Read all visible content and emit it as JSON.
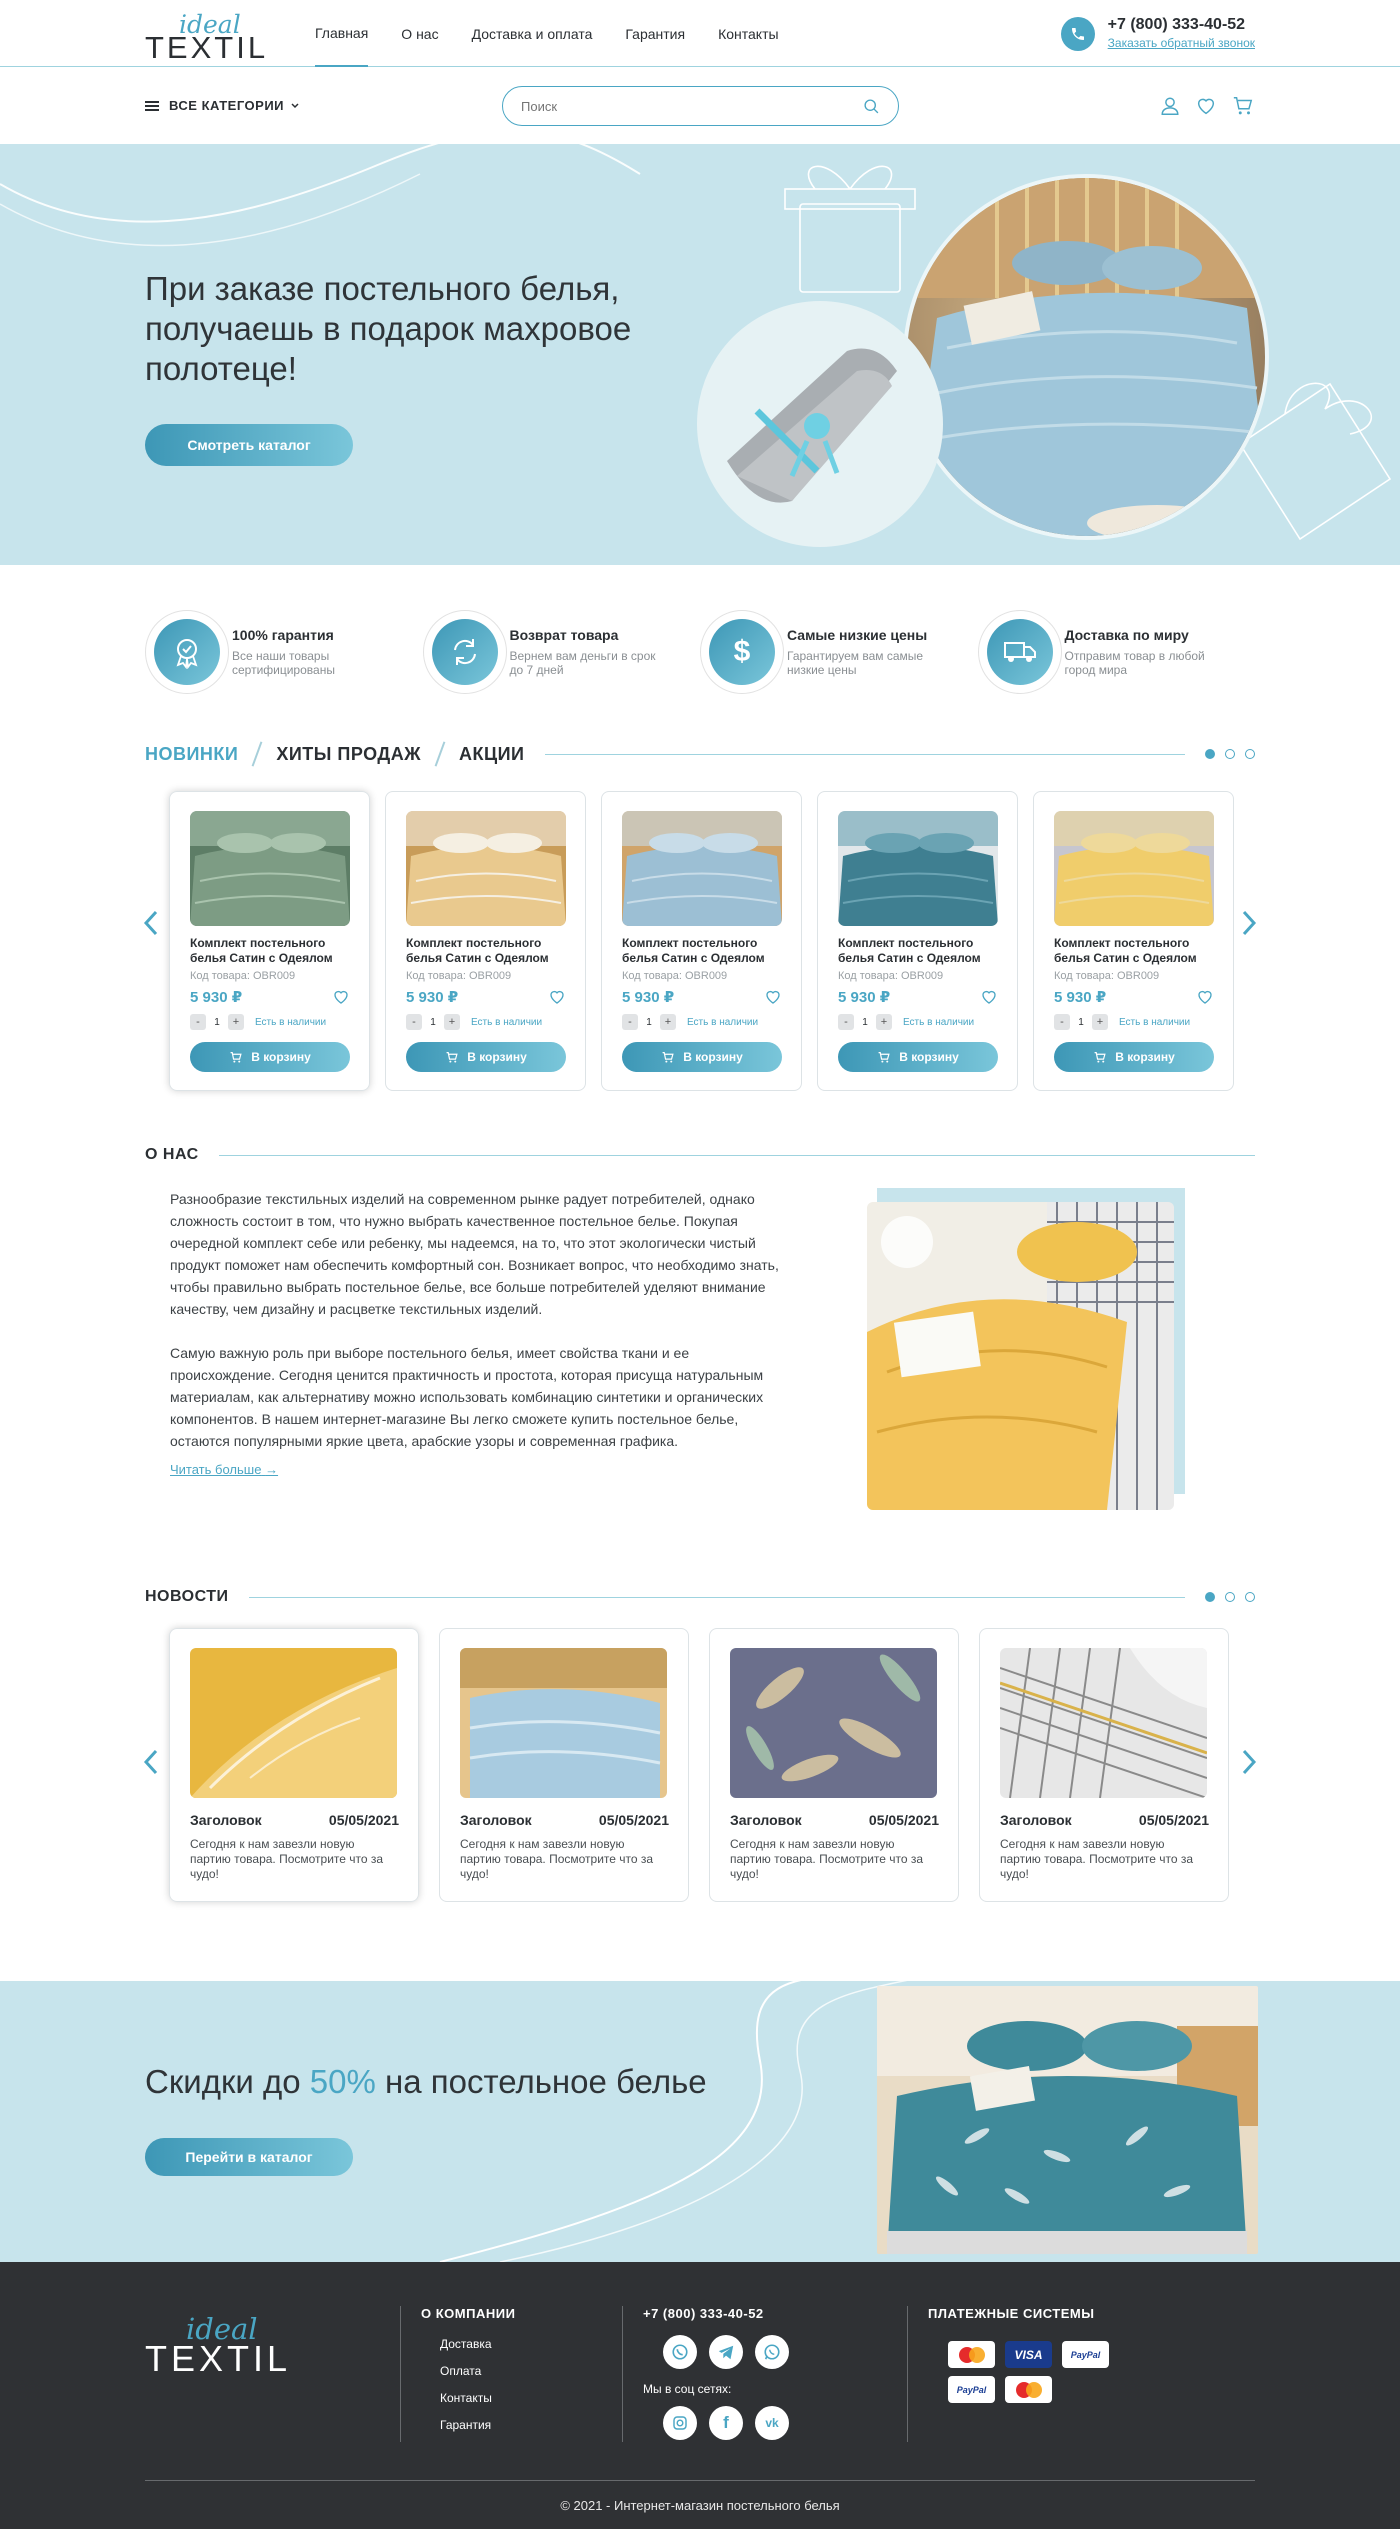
{
  "header": {
    "logo_script": "ideal",
    "logo_main": "TEXTIL",
    "nav": [
      "Главная",
      "О нас",
      "Доставка и оплата",
      "Гарантия",
      "Контакты"
    ],
    "phone": "+7 (800) 333-40-52",
    "callback": "Заказать обратный звонок",
    "categories": "ВСЕ КАТЕГОРИИ",
    "search_placeholder": "Поиск"
  },
  "hero": {
    "title": "При заказе постельного белья, получаешь в подарок махровое полотеце!",
    "button": "Смотреть каталог"
  },
  "features": [
    {
      "icon": "award-icon",
      "title": "100% гарантия",
      "sub": "Все наши товары сертифицированы"
    },
    {
      "icon": "refresh-icon",
      "title": "Возврат товара",
      "sub": "Вернем вам деньги в срок до 7 дней"
    },
    {
      "icon": "dollar-icon",
      "title": "Самые низкие цены",
      "sub": "Гарантируем вам самые низкие цены"
    },
    {
      "icon": "truck-icon",
      "title": "Доставка по миру",
      "sub": "Отправим товар в любой город мира"
    }
  ],
  "tabs": [
    "НОВИНКИ",
    "ХИТЫ ПРОДАЖ",
    "АКЦИИ"
  ],
  "products": [
    {
      "name": "Комплект постельного белья Сатин с Одеялом",
      "code": "Код товара: OBR009",
      "price": "5 930 ₽",
      "qty": "1",
      "stock": "Есть в наличии",
      "button": "В корзину"
    },
    {
      "name": "Комплект постельного белья Сатин с Одеялом",
      "code": "Код товара: OBR009",
      "price": "5 930 ₽",
      "qty": "1",
      "stock": "Есть в наличии",
      "button": "В корзину"
    },
    {
      "name": "Комплект постельного белья Сатин с Одеялом",
      "code": "Код товара: OBR009",
      "price": "5 930 ₽",
      "qty": "1",
      "stock": "Есть в наличии",
      "button": "В корзину"
    },
    {
      "name": "Комплект постельного белья Сатин с Одеялом",
      "code": "Код товара: OBR009",
      "price": "5 930 ₽",
      "qty": "1",
      "stock": "Есть в наличии",
      "button": "В корзину"
    },
    {
      "name": "Комплект постельного белья Сатин с Одеялом",
      "code": "Код товара: OBR009",
      "price": "5 930 ₽",
      "qty": "1",
      "stock": "Есть в наличии",
      "button": "В корзину"
    }
  ],
  "about": {
    "title": "О НАС",
    "p1": "Разнообразие текстильных изделий на современном рынке радует потребителей, однако сложность состоит в том, что нужно выбрать качественное постельное белье. Покупая очередной комплект себе или ребенку, мы надеемся, на то, что этот экологически чистый продукт поможет нам обеспечить комфортный сон. Возникает вопрос, что необходимо знать, чтобы правильно выбрать постельное белье, все больше потребителей уделяют внимание качеству, чем дизайну и расцветке текстильных изделий.",
    "p2": "Самую важную роль при выборе постельного белья, имеет свойства ткани и ее происхождение. Сегодня ценится практичность и простота, которая присуща натуральным материалам, как альтернативу можно использовать комбинацию синтетики и органических компонентов. В нашем интернет-магазине Вы легко сможете купить постельное белье, остаются популярными яркие цвета, арабские узоры и современная графика.",
    "read_more": "Читать больше"
  },
  "news": {
    "title": "НОВОСТИ",
    "items": [
      {
        "title": "Заголовок",
        "date": "05/05/2021",
        "text": "Сегодня к нам завезли новую партию товара. Посмотрите что за чудо!"
      },
      {
        "title": "Заголовок",
        "date": "05/05/2021",
        "text": "Сегодня к нам завезли новую партию товара. Посмотрите что за чудо!"
      },
      {
        "title": "Заголовок",
        "date": "05/05/2021",
        "text": "Сегодня к нам завезли новую партию товара. Посмотрите что за чудо!"
      },
      {
        "title": "Заголовок",
        "date": "05/05/2021",
        "text": "Сегодня к нам завезли новую партию товара. Посмотрите что за чудо!"
      }
    ]
  },
  "promo": {
    "pre": "Скидки до ",
    "pct": "50%",
    "post": " на постельное белье",
    "button": "Перейти в каталог"
  },
  "footer": {
    "company_title": "О КОМПАНИИ",
    "links": [
      "Доставка",
      "Оплата",
      "Контакты",
      "Гарантия"
    ],
    "phone": "+7 (800) 333-40-52",
    "social_label": "Мы в соц сетях:",
    "pay_title": "ПЛАТЕЖНЫЕ СИСТЕМЫ",
    "pays": [
      "MasterCard",
      "VISA",
      "PayPal",
      "PayPal",
      "MasterCard"
    ],
    "copyright": "© 2021 - Интернет-магазин постельного белья"
  },
  "colors": {
    "accent": "#4aa6c4",
    "hero_bg": "#c7e4ec",
    "footer_bg": "#2f3134"
  }
}
